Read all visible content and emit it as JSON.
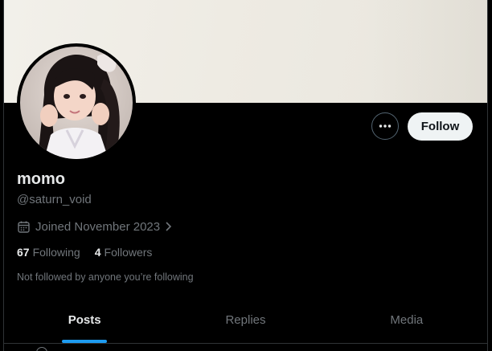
{
  "profile": {
    "display_name": "momo",
    "handle": "@saturn_void",
    "joined": "Joined November 2023",
    "following_count": "67",
    "following_label": "Following",
    "followers_count": "4",
    "followers_label": "Followers",
    "not_followed_text": "Not followed by anyone you’re following"
  },
  "actions": {
    "more_icon": "more-horizontal-icon",
    "follow_label": "Follow"
  },
  "tabs": [
    {
      "label": "Posts",
      "active": true
    },
    {
      "label": "Replies",
      "active": false
    },
    {
      "label": "Media",
      "active": false
    }
  ],
  "colors": {
    "background": "#000000",
    "banner": "#eeebe3",
    "primary_text": "#e7e9ea",
    "secondary_text": "#71767b",
    "follow_button_bg": "#eff3f4",
    "accent": "#1d9bf0"
  }
}
